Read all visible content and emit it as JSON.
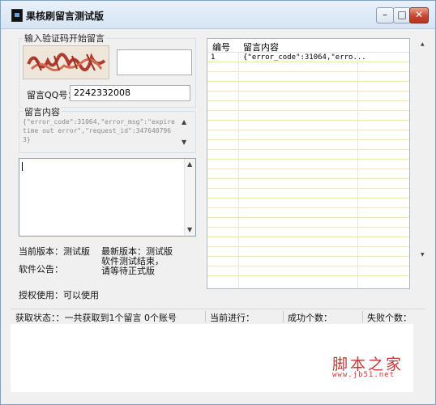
{
  "window": {
    "title": "果核刷留言测试版",
    "minimize_glyph": "–",
    "maximize_glyph": "□",
    "close_glyph": "✕"
  },
  "captcha_group": {
    "label": "输入验证码开始留言",
    "qq_label": "留言QQ号：",
    "qq_value": "2242332008"
  },
  "message_group": {
    "label": "留言内容",
    "content": "{\"error_code\":31064,\"error_msg\":\"expire time out error\",\"request_id\":3476407963}"
  },
  "info": {
    "current_version_label": "当前版本：测试版",
    "latest_version_label": "最新版本：测试版",
    "notice_label": "软件公告：",
    "notice_text": "软件测试结束，请等待正式版",
    "license_label": "授权使用：可以使用"
  },
  "list": {
    "columns": [
      "编号",
      "留言内容"
    ],
    "rows": [
      {
        "id": "1",
        "content": "{\"error_code\":31064,\"erro..."
      }
    ]
  },
  "status_bar": {
    "fetch_status": "获取状态：：一共获取到1个留言   0个账号",
    "current_progress": "当前进行：",
    "success_count": "成功个数：",
    "fail_count": "失败个数："
  },
  "watermark": {
    "chinese": "脚本之家",
    "url": "www.jb51.net"
  },
  "icons": [
    "app-icon",
    "minimize-icon",
    "maximize-icon",
    "close-icon",
    "scroll-up-icon",
    "scroll-down-icon"
  ]
}
